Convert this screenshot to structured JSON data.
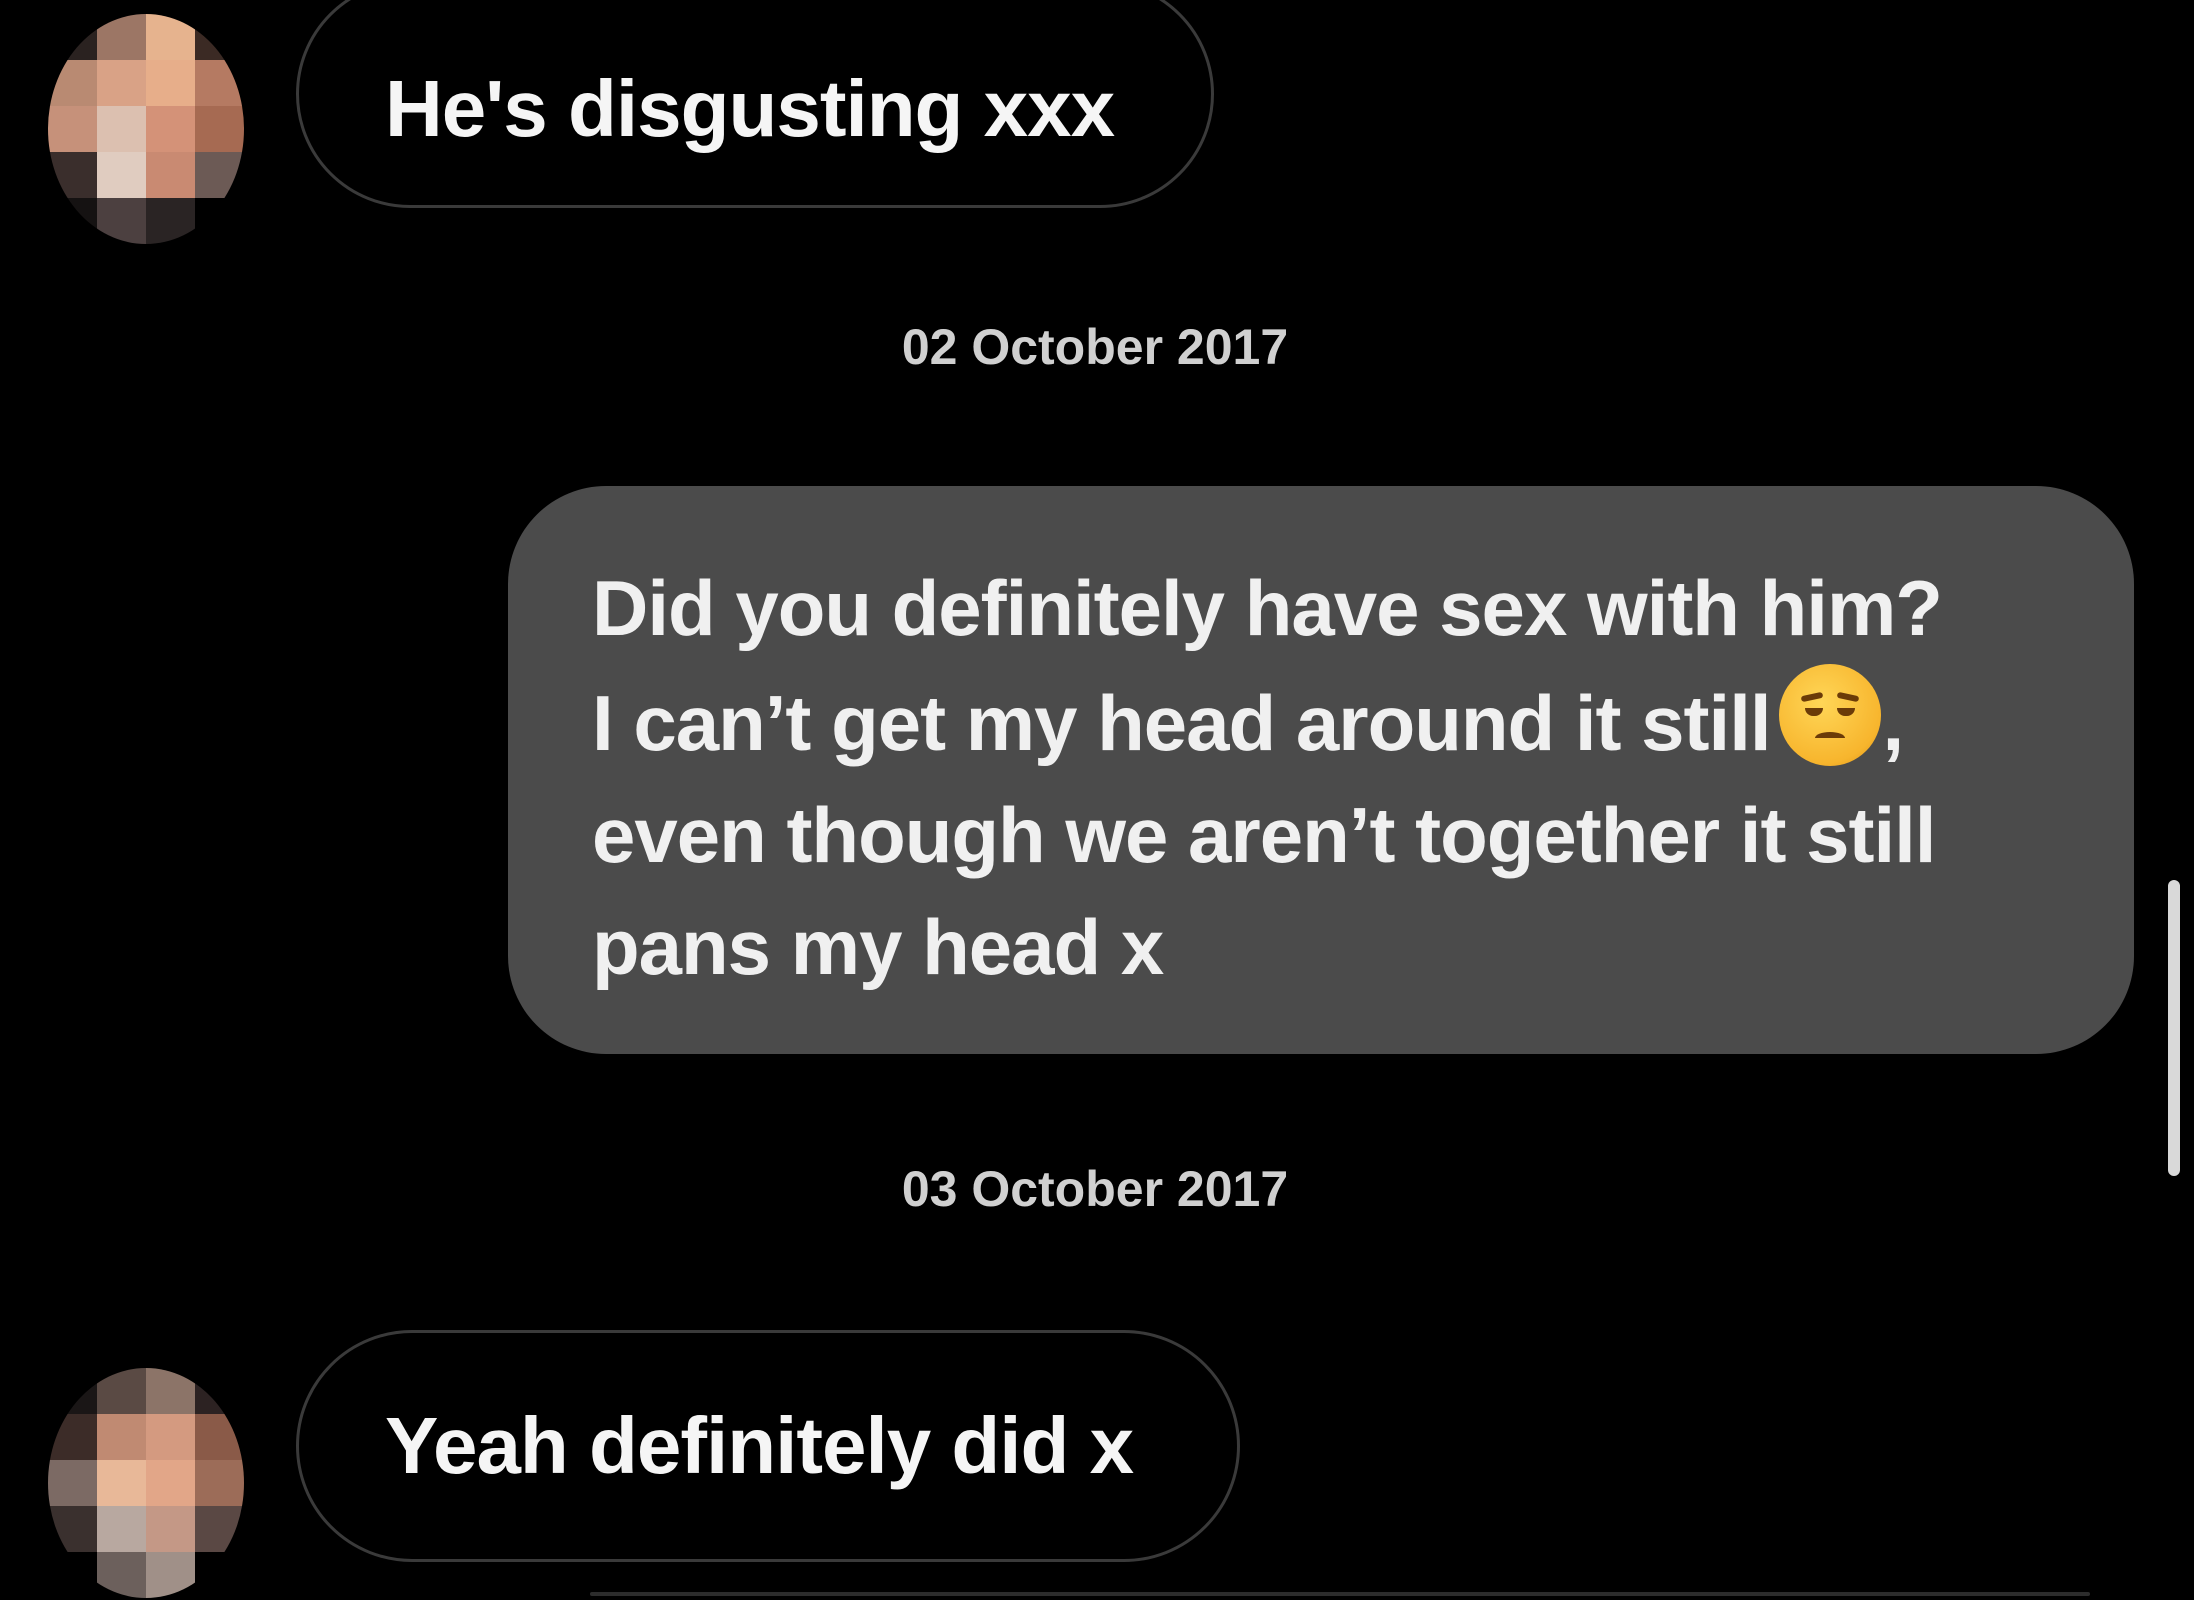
{
  "conversation": {
    "messages": [
      {
        "direction": "received",
        "text": "He's disgusting xxx"
      },
      {
        "direction": "separator",
        "text": "02 October 2017"
      },
      {
        "direction": "sent",
        "lines": [
          "Did you definitely have sex with him?",
          "I can’t get my head around it still",
          "even though we aren’t together it still",
          "pans my head x"
        ],
        "line2_suffix": ",",
        "emoji": "unamused-face-icon"
      },
      {
        "direction": "separator",
        "text": "03 October 2017"
      },
      {
        "direction": "received",
        "text": "Yeah definitely did x"
      }
    ]
  },
  "colors": {
    "background": "#000000",
    "sent_bubble": "#4b4b4b",
    "received_border": "#3a3a3a"
  }
}
